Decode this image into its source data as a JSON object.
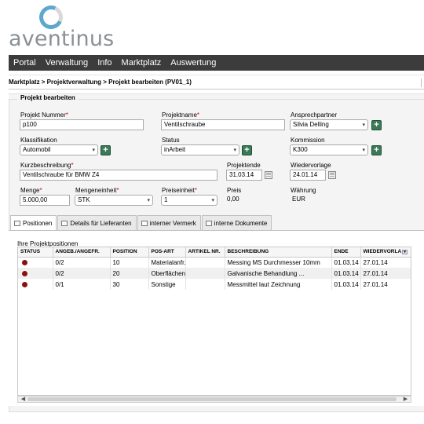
{
  "brand": {
    "name": "aventinus"
  },
  "nav": [
    "Portal",
    "Verwaltung",
    "Info",
    "Marktplatz",
    "Auswertung"
  ],
  "breadcrumb": "Marktplatz > Projektverwaltung > Projekt bearbeiten (PV01_1)",
  "section_title": "Projekt bearbeiten",
  "form": {
    "projektnummer": {
      "label": "Projekt Nummer",
      "value": "p100"
    },
    "projektname": {
      "label": "Projektname",
      "value": "Ventilschraube"
    },
    "ansprechpartner": {
      "label": "Ansprechpartner",
      "value": "Silvia Delling"
    },
    "klassifikation": {
      "label": "Klassifikation",
      "value": "Automobil"
    },
    "status": {
      "label": "Status",
      "value": "inArbeit"
    },
    "kommission": {
      "label": "Kommission",
      "value": "K300"
    },
    "kurzbeschreibung": {
      "label": "Kurzbeschreibung",
      "value": "Ventilschraube für BMW Z4"
    },
    "projektende": {
      "label": "Projektende",
      "value": "31.03.14"
    },
    "wiedervorlage": {
      "label": "Wiedervorlage",
      "value": "24.01.14"
    },
    "menge": {
      "label": "Menge",
      "value": "5.000,00"
    },
    "mengeneinheit": {
      "label": "Mengeneinheit",
      "value": "STK"
    },
    "preiseinheit": {
      "label": "Preiseinheit",
      "value": "1"
    },
    "preis": {
      "label": "Preis",
      "value": "0,00"
    },
    "waehrung": {
      "label": "Währung",
      "value": "EUR"
    },
    "required_mark": "*"
  },
  "tabs": [
    "Positionen",
    "Details für Lieferanten",
    "interner Vermerk",
    "interne Dokumente"
  ],
  "grid": {
    "title": "Ihre Projektpositionen",
    "columns": [
      "STATUS",
      "ANGEB./ANGEFR.",
      "POSITION",
      "POS-ART",
      "ARTIKEL NR.",
      "BESCHREIBUNG",
      "ENDE",
      "WIEDERVORLA"
    ],
    "rows": [
      {
        "status": "red",
        "angeb": "0/2",
        "position": "10",
        "posart": "Materialanfr.",
        "artikel": "",
        "beschreibung": "Messing MS Durchmesser 10mm",
        "ende": "01.03.14",
        "wv": "27.01.14"
      },
      {
        "status": "red",
        "angeb": "0/2",
        "position": "20",
        "posart": "Oberflächen",
        "artikel": "",
        "beschreibung": "Galvanische Behandlung ...",
        "ende": "01.03.14",
        "wv": "27.01.14"
      },
      {
        "status": "red",
        "angeb": "0/1",
        "position": "30",
        "posart": "Sonstige",
        "artikel": "",
        "beschreibung": "Messmittel laut Zeichnung",
        "ende": "01.03.14",
        "wv": "27.01.14"
      }
    ]
  },
  "colors": {
    "nav_bg": "#3c3c3c",
    "accent": "#5ba7cf",
    "status_red": "#8b0f0f",
    "plus_button": "#3b7a57"
  }
}
